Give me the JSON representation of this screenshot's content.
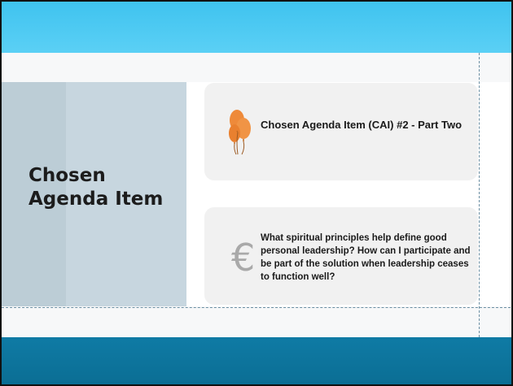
{
  "slide": {
    "title": "Chosen Agenda Item",
    "cards": [
      {
        "text": "Chosen Agenda Item (CAI) #2 - Part Two",
        "icon": "balloons-icon"
      },
      {
        "text": "What spiritual principles help define good personal leadership? How can I participate and be part of the solution when leadership ceases to function well?",
        "icon": "euro-icon",
        "glyph": "€"
      }
    ]
  },
  "colors": {
    "top_band": "#4fcbf3",
    "bottom_band": "#0d729c",
    "left_panel": "#c7d6df",
    "card": "#f1f1f1",
    "balloon": "#ee8a3a",
    "euro": "#a9a9a9"
  }
}
